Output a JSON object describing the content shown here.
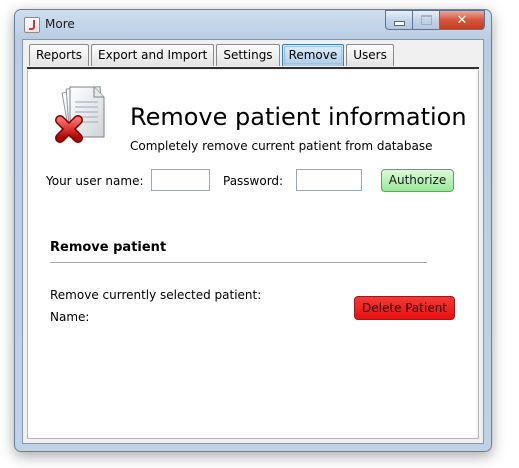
{
  "window": {
    "title": "More",
    "controls": {
      "minimize": "minimize-icon",
      "maximize": "maximize-icon",
      "close": "close-icon"
    }
  },
  "tabs": [
    {
      "label": "Reports"
    },
    {
      "label": "Export and Import"
    },
    {
      "label": "Settings"
    },
    {
      "label": "Remove",
      "selected": true
    },
    {
      "label": "Users"
    }
  ],
  "header": {
    "icon": "document-delete-icon",
    "title": "Remove patient information",
    "subtitle": "Completely remove current patient from database"
  },
  "auth": {
    "username_label": "Your user name:",
    "username_value": "",
    "password_label": "Password:",
    "password_value": "",
    "authorize_label": "Authorize"
  },
  "remove_section": {
    "title": "Remove patient",
    "selected_label": "Remove currently selected patient:",
    "name_label": "Name:",
    "delete_label": "Delete Patient"
  },
  "colors": {
    "authorize_button": "#99e897",
    "delete_button": "#e80f0f",
    "active_tab": "#a9cbea"
  }
}
